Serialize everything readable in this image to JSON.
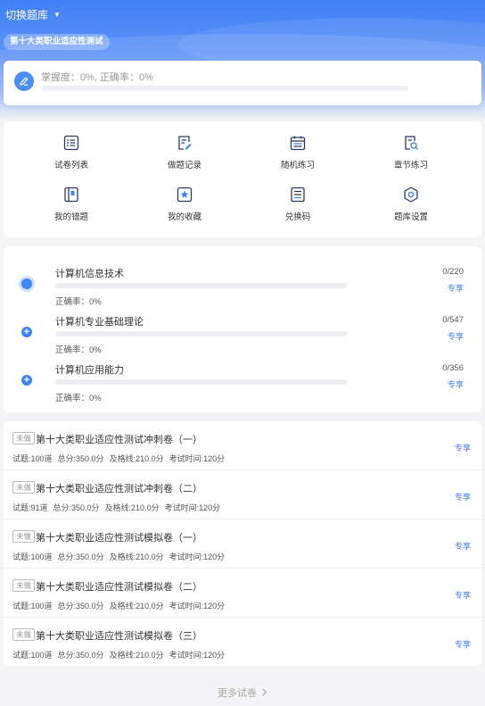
{
  "header": {
    "switch_label": "切换题库",
    "caret": "▼",
    "bank_name": "第十大类职业适应性测试"
  },
  "mastery": {
    "text": "掌握度：0%, 正确率：0%",
    "progress": 0
  },
  "menu": [
    {
      "label": "试卷列表",
      "icon": "list-icon"
    },
    {
      "label": "做题记录",
      "icon": "record-icon"
    },
    {
      "label": "随机练习",
      "icon": "calendar-icon"
    },
    {
      "label": "章节练习",
      "icon": "search-doc-icon"
    },
    {
      "label": "我的错题",
      "icon": "book-icon"
    },
    {
      "label": "我的收藏",
      "icon": "star-icon"
    },
    {
      "label": "兑换码",
      "icon": "code-icon"
    },
    {
      "label": "题库设置",
      "icon": "settings-icon"
    }
  ],
  "subjects": [
    {
      "name": "计算机信息技术",
      "count": "0/220",
      "tag": "专享",
      "accuracy": "正确率：0%",
      "progress": 0
    },
    {
      "name": "计算机专业基础理论",
      "count": "0/547",
      "tag": "专享",
      "accuracy": "正确率：0%",
      "progress": 0
    },
    {
      "name": "计算机应用能力",
      "count": "0/356",
      "tag": "专享",
      "accuracy": "正确率：0%",
      "progress": 0
    }
  ],
  "papers": [
    {
      "status": "未做",
      "title": "第十大类职业适应性测试冲刺卷（一）",
      "questions": "试题:100道",
      "total": "总分:350.0分",
      "pass": "及格线:210.0分",
      "time": "考试时间:120分",
      "tag": "专享"
    },
    {
      "status": "未做",
      "title": "第十大类职业适应性测试冲刺卷（二）",
      "questions": "试题:91道",
      "total": "总分:350.0分",
      "pass": "及格线:210.0分",
      "time": "考试时间:120分",
      "tag": "专享"
    },
    {
      "status": "未做",
      "title": "第十大类职业适应性测试模拟卷（一）",
      "questions": "试题:100道",
      "total": "总分:350.0分",
      "pass": "及格线:210.0分",
      "time": "考试时间:120分",
      "tag": "专享"
    },
    {
      "status": "未做",
      "title": "第十大类职业适应性测试模拟卷（二）",
      "questions": "试题:100道",
      "total": "总分:350.0分",
      "pass": "及格线:210.0分",
      "time": "考试时间:120分",
      "tag": "专享"
    },
    {
      "status": "未做",
      "title": "第十大类职业适应性测试模拟卷（三）",
      "questions": "试题:100道",
      "total": "总分:350.0分",
      "pass": "及格线:210.0分",
      "time": "考试时间:120分",
      "tag": "专享"
    }
  ],
  "more_label": "更多试卷",
  "more_icon": "chevron-right-icon",
  "colors": {
    "accent": "#3d86f5",
    "tag": "#3a7df3"
  }
}
